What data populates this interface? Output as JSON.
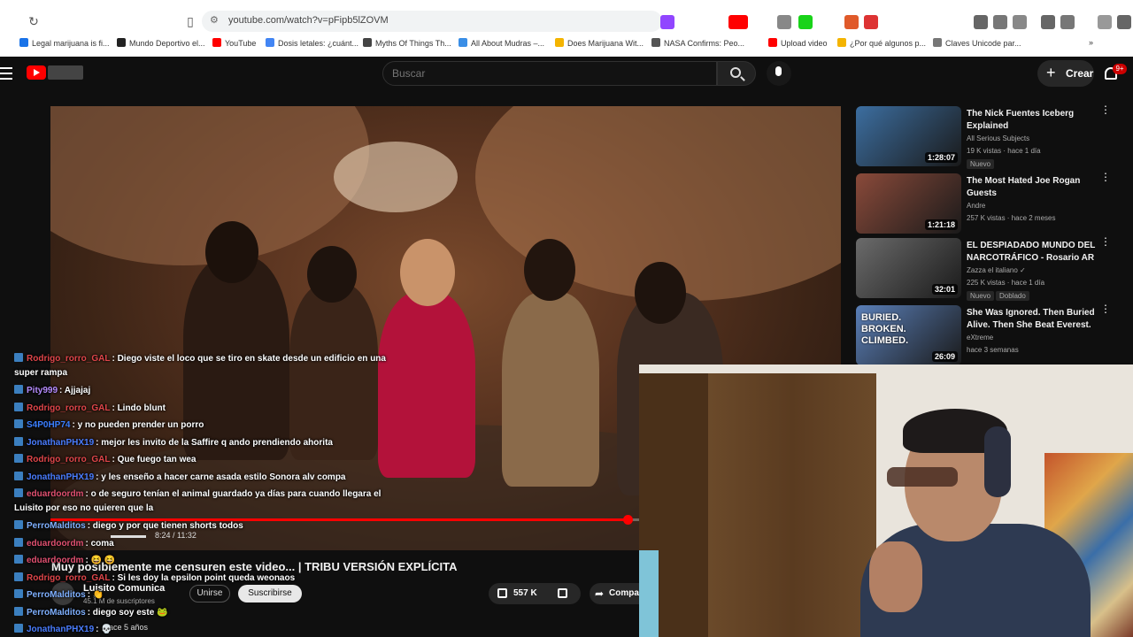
{
  "browser": {
    "url": "youtube.com/watch?v=pFipb5lZOVM",
    "bookmarks": [
      {
        "label": "Legal marijuana is fi...",
        "color": "#1a73e8"
      },
      {
        "label": "Mundo Deportivo el...",
        "color": "#222222"
      },
      {
        "label": "YouTube",
        "color": "#ff0000"
      },
      {
        "label": "Dosis letales: ¿cuánt...",
        "color": "#4285f4"
      },
      {
        "label": "Myths Of Things Th...",
        "color": "#444444"
      },
      {
        "label": "All About Mudras –...",
        "color": "#3a8ee6"
      },
      {
        "label": "Does Marijuana Wit...",
        "color": "#f4b400"
      },
      {
        "label": "NASA Confirms: Peo...",
        "color": "#555555"
      },
      {
        "label": "Upload video",
        "color": "#ff0000"
      },
      {
        "label": "¿Por qué algunos p...",
        "color": "#f4b400"
      },
      {
        "label": "Claves Unicode par...",
        "color": "#777777"
      }
    ]
  },
  "header": {
    "search_placeholder": "Buscar",
    "create_label": "Crear",
    "create_plus": "+",
    "notif_count": "9+"
  },
  "video": {
    "title": "Muy posiblemente me censuren este video... | TRIBU VERSIÓN EXPLÍCITA",
    "channel": "Luisito Comunica",
    "subscribers": "45.1 M de suscriptores",
    "join_label": "Unirse",
    "subscribe_label": "Suscribirse",
    "likes": "557 K",
    "share_label": "Compartir",
    "time": "8:24 / 11:32",
    "uploaded": "hace 5 años",
    "progress": 0.73
  },
  "recommendations": [
    {
      "title": "The Nick Fuentes Iceberg Explained",
      "channel": "All Serious Subjects",
      "meta": "19 K vistas · hace 1 día",
      "badge": "Nuevo",
      "badge2": "",
      "duration": "1:28:07",
      "thumb": "#3c6ea0"
    },
    {
      "title": "The Most Hated Joe Rogan Guests",
      "channel": "Andre",
      "meta": "257 K vistas · hace 2 meses",
      "badge": "",
      "badge2": "",
      "duration": "1:21:18",
      "thumb": "#8a4a3a"
    },
    {
      "title": "EL DESPIADADO MUNDO DEL NARCOTRÁFICO - Rosario AR",
      "channel": "Zazza el italiano ✓",
      "meta": "225 K vistas · hace 1 día",
      "badge": "Nuevo",
      "badge2": "Doblado",
      "duration": "32:01",
      "thumb": "#6b6b6b"
    },
    {
      "title": "She Was Ignored. Then Buried Alive. Then She Beat Everest.",
      "channel": "eXtreme",
      "meta": "hace 3 semanas",
      "badge": "",
      "badge2": "",
      "duration": "26:09",
      "thumb": "#5a7fb8",
      "thumb_text": "BURIED. BROKEN. CLIMBED."
    }
  ],
  "chat": [
    {
      "user": "Rodrigo_rorro_GAL",
      "color": "#e0464a",
      "text": "Diego viste el loco que se tiro en skate desde un edificio en una super rampa",
      "wrap": true
    },
    {
      "user": "Pity999",
      "color": "#b58cff",
      "text": "Ajjajaj",
      "wrap": false
    },
    {
      "user": "Rodrigo_rorro_GAL",
      "color": "#e0464a",
      "text": "Lindo blunt",
      "wrap": false
    },
    {
      "user": "S4P0HP74",
      "color": "#3b7fff",
      "text": "y no pueden prender un porro",
      "wrap": false
    },
    {
      "user": "JonathanPHX19",
      "color": "#4a7dff",
      "text": "mejor les invito de la Saffire q ando prendiendo ahorita",
      "wrap": false
    },
    {
      "user": "Rodrigo_rorro_GAL",
      "color": "#e0464a",
      "text": "Que fuego tan wea",
      "wrap": false
    },
    {
      "user": "JonathanPHX19",
      "color": "#4a7dff",
      "text": "y les enseño a hacer carne asada estilo Sonora alv compa",
      "wrap": false
    },
    {
      "user": "eduardoordm",
      "color": "#e05070",
      "text": "o de seguro tenían el animal guardado ya días para cuando llegara el Luisito por eso no quieren que la",
      "wrap": true
    },
    {
      "user": "PerroMalditos",
      "color": "#7fb0ff",
      "text": "diego y por que tienen shorts todos",
      "wrap": false
    },
    {
      "user": "eduardoordm",
      "color": "#e05070",
      "text": "coma",
      "wrap": false
    },
    {
      "user": "eduardoordm",
      "color": "#e05070",
      "text": "😆 😆",
      "wrap": false
    },
    {
      "user": "Rodrigo_rorro_GAL",
      "color": "#e0464a",
      "text": "Si les doy la epsilon point queda weonaos",
      "wrap": false
    },
    {
      "user": "PerroMalditos",
      "color": "#7fb0ff",
      "text": "👏",
      "wrap": false
    },
    {
      "user": "PerroMalditos",
      "color": "#7fb0ff",
      "text": "diego soy este 🐸",
      "wrap": false
    },
    {
      "user": "JonathanPHX19",
      "color": "#4a7dff",
      "text": "💀",
      "wrap": false
    }
  ]
}
